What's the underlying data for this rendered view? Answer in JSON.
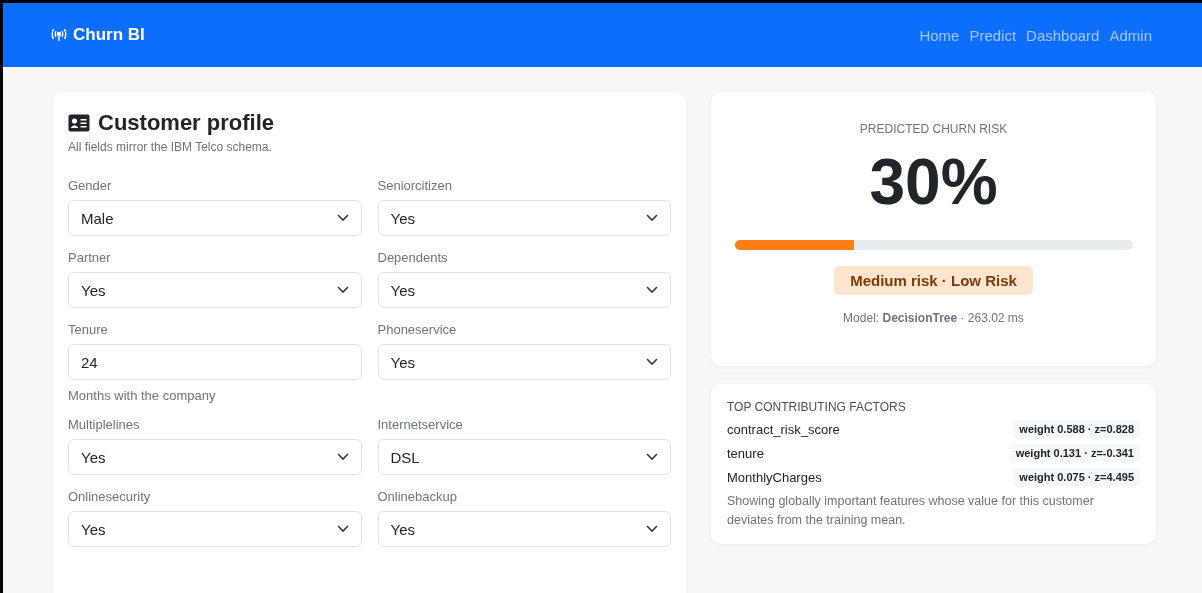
{
  "navbar": {
    "brand": "Churn BI",
    "links": [
      {
        "label": "Home"
      },
      {
        "label": "Predict"
      },
      {
        "label": "Dashboard"
      },
      {
        "label": "Admin"
      }
    ]
  },
  "profile": {
    "title": "Customer profile",
    "subtitle": "All fields mirror the IBM Telco schema.",
    "fields": [
      {
        "label": "Gender",
        "kind": "select",
        "value": "Male"
      },
      {
        "label": "Seniorcitizen",
        "kind": "select",
        "value": "Yes"
      },
      {
        "label": "Partner",
        "kind": "select",
        "value": "Yes"
      },
      {
        "label": "Dependents",
        "kind": "select",
        "value": "Yes"
      },
      {
        "label": "Tenure",
        "kind": "input",
        "value": "24",
        "help": "Months with the company"
      },
      {
        "label": "Phoneservice",
        "kind": "select",
        "value": "Yes"
      },
      {
        "label": "Multiplelines",
        "kind": "select",
        "value": "Yes"
      },
      {
        "label": "Internetservice",
        "kind": "select",
        "value": "DSL"
      },
      {
        "label": "Onlinesecurity",
        "kind": "select",
        "value": "Yes"
      },
      {
        "label": "Onlinebackup",
        "kind": "select",
        "value": "Yes"
      }
    ]
  },
  "risk": {
    "heading": "PREDICTED CHURN RISK",
    "value": "30%",
    "level": 0.3,
    "badge": "Medium risk · Low Risk",
    "model": "Model: **DecisionTree** · 263.02 ms"
  },
  "factors": {
    "heading": "TOP CONTRIBUTING FACTORS",
    "items": [
      {
        "name": "contract_risk_score",
        "weight": "weight 0.588 · z=0.828"
      },
      {
        "name": "tenure",
        "weight": "weight 0.131 · z=-0.341"
      },
      {
        "name": "MonthlyCharges",
        "weight": "weight 0.075 · z=4.495"
      }
    ],
    "note": "Showing globally important features whose value for this customer deviates from the training mean."
  }
}
